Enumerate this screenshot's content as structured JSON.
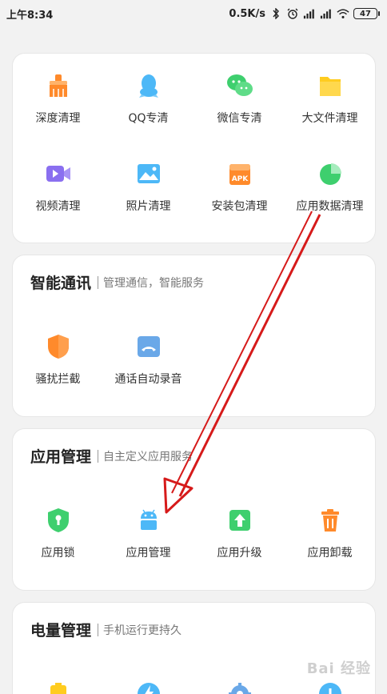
{
  "status_bar": {
    "time": "上午8:34",
    "network_speed": "0.5K/s",
    "battery": "47"
  },
  "clean_section": {
    "items": [
      {
        "label": "深度清理",
        "icon": "broom-icon"
      },
      {
        "label": "QQ专清",
        "icon": "qq-icon"
      },
      {
        "label": "微信专清",
        "icon": "wechat-icon"
      },
      {
        "label": "大文件清理",
        "icon": "folder-icon"
      },
      {
        "label": "视频清理",
        "icon": "video-icon"
      },
      {
        "label": "照片清理",
        "icon": "photo-icon"
      },
      {
        "label": "安装包清理",
        "icon": "apk-icon"
      },
      {
        "label": "应用数据清理",
        "icon": "pie-chart-icon"
      }
    ],
    "apk_text": "APK"
  },
  "smart_comm": {
    "title": "智能通讯",
    "subtitle": "管理通信，智能服务",
    "items": [
      {
        "label": "骚扰拦截",
        "icon": "shield-icon"
      },
      {
        "label": "通话自动录音",
        "icon": "call-record-icon"
      }
    ]
  },
  "app_manage": {
    "title": "应用管理",
    "subtitle": "自主定义应用服务",
    "items": [
      {
        "label": "应用锁",
        "icon": "lock-shield-icon"
      },
      {
        "label": "应用管理",
        "icon": "android-icon"
      },
      {
        "label": "应用升级",
        "icon": "upgrade-icon"
      },
      {
        "label": "应用卸载",
        "icon": "trash-icon"
      }
    ]
  },
  "power_manage": {
    "title": "电量管理",
    "subtitle": "手机运行更持久"
  },
  "watermark": "Bai 经验",
  "colors": {
    "orange": "#ff8a2b",
    "blue": "#4db8f7",
    "green": "#3ecf6e",
    "yellow": "#ffcc1f",
    "purple": "#8a6ff0",
    "annotation_red": "#d61a1a"
  }
}
